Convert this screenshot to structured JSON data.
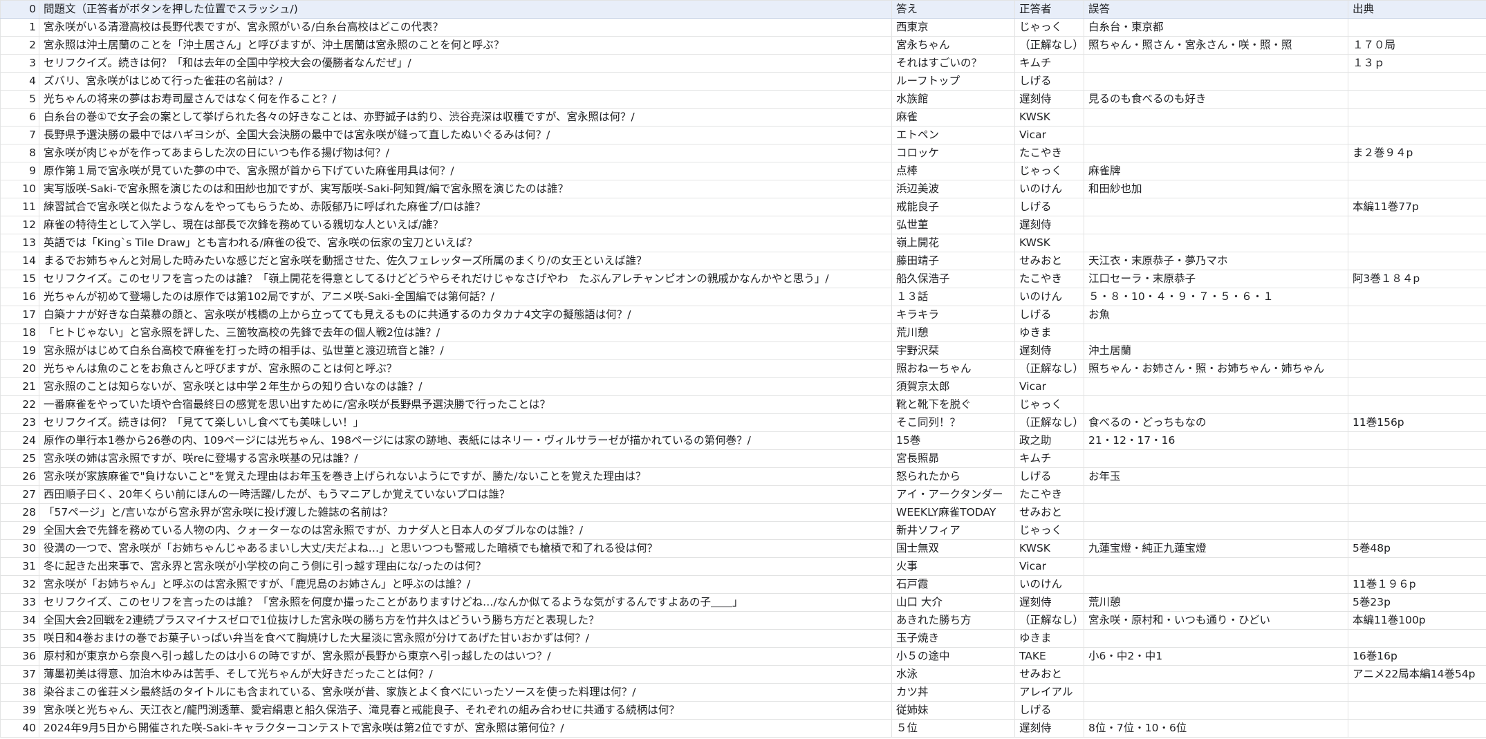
{
  "header": {
    "index": "0",
    "question": "問題文（正答者がボタンを押した位置でスラッシュ/)",
    "answer": "答え",
    "correct": "正答者",
    "wrong": "誤答",
    "source": "出典"
  },
  "rows": [
    {
      "i": "1",
      "q": "宮永咲がいる清澄高校は長野代表ですが、宮永照がいる/白糸台高校はどこの代表？",
      "a": "西東京",
      "c": "じゃっく",
      "w": "白糸台・東京都",
      "s": ""
    },
    {
      "i": "2",
      "q": "宮永照は沖土居蘭のことを「沖土居さん」と呼びますが、沖土居蘭は宮永照のことを何と呼ぶ？",
      "a": "宮永ちゃん",
      "c": "（正解なし）",
      "w": "照ちゃん・照さん・宮永さん・咲・照・照",
      "s": "１７０局"
    },
    {
      "i": "3",
      "q": "セリフクイズ。続きは何？「和は去年の全国中学校大会の優勝者なんだぜ」/",
      "a": "それはすごいの？",
      "c": "キムチ",
      "w": "",
      "s": "１３ｐ"
    },
    {
      "i": "4",
      "q": "ズバリ、宮永咲がはじめて行った雀荘の名前は？/",
      "a": "ルーフトップ",
      "c": "しげる",
      "w": "",
      "s": ""
    },
    {
      "i": "5",
      "q": "光ちゃんの将来の夢はお寿司屋さんではなく何を作ること？/",
      "a": "水族館",
      "c": "遅刻侍",
      "w": "見るのも食べるのも好き",
      "s": ""
    },
    {
      "i": "6",
      "q": "白糸台の巻①で女子会の案として挙げられた各々の好きなことは、亦野誠子は釣り、渋谷尭深は収穫ですが、宮永照は何？/",
      "a": "麻雀",
      "c": "KWSK",
      "w": "",
      "s": ""
    },
    {
      "i": "7",
      "q": "長野県予選決勝の最中ではハギヨシが、全国大会決勝の最中では宮永咲が縫って直したぬいぐるみは何？/",
      "a": "エトペン",
      "c": "Vicar",
      "w": "",
      "s": ""
    },
    {
      "i": "8",
      "q": "宮永咲が肉じゃがを作ってあまらした次の日にいつも作る揚げ物は何？/",
      "a": "コロッケ",
      "c": "たこやき",
      "w": "",
      "s": "ま２巻９４p"
    },
    {
      "i": "9",
      "q": "原作第１局で宮永咲が見ていた夢の中で、宮永照が首から下げていた麻雀用具は何？/",
      "a": "点棒",
      "c": "じゃっく",
      "w": "麻雀牌",
      "s": ""
    },
    {
      "i": "10",
      "q": "実写版咲-Saki-で宮永照を演じたのは和田紗也加ですが、実写版咲-Saki-阿知賀/編で宮永照を演じたのは誰？",
      "a": "浜辺美波",
      "c": "いのけん",
      "w": "和田紗也加",
      "s": ""
    },
    {
      "i": "11",
      "q": "練習試合で宮永咲と似たようなんをやってもらうため、赤阪郁乃に呼ばれた麻雀プ/ロは誰？",
      "a": "戒能良子",
      "c": "しげる",
      "w": "",
      "s": "本編11巻77p"
    },
    {
      "i": "12",
      "q": "麻雀の特待生として入学し、現在は部長で次鋒を務めている親切な人といえば/誰？",
      "a": "弘世菫",
      "c": "遅刻侍",
      "w": "",
      "s": ""
    },
    {
      "i": "13",
      "q": "英語では「King`s Tile Draw」とも言われる/麻雀の役で、宮永咲の伝家の宝刀といえば？",
      "a": "嶺上開花",
      "c": "KWSK",
      "w": "",
      "s": ""
    },
    {
      "i": "14",
      "q": "まるでお姉ちゃんと対局した時みたいな感じだと宮永咲を動揺させた、佐久フェレッターズ所属のまくり/の女王といえば誰？",
      "a": "藤田靖子",
      "c": "せみおと",
      "w": "天江衣・末原恭子・夢乃マホ",
      "s": ""
    },
    {
      "i": "15",
      "q": "セリフクイズ。このセリフを言ったのは誰？「嶺上開花を得意としてるけどどうやらそれだけじゃなさげやわ　たぶんアレチャンピオンの親戚かなんかやと思う」/",
      "a": "船久保浩子",
      "c": "たこやき",
      "w": "江口セーラ・末原恭子",
      "s": "阿3巻１８４p"
    },
    {
      "i": "16",
      "q": "光ちゃんが初めて登場したのは原作では第102局ですが、アニメ咲-Saki-全国編では第何話？/",
      "a": "１３話",
      "c": "いのけん",
      "w": "５・８・10・４・９・７・５・６・１",
      "s": ""
    },
    {
      "i": "17",
      "q": "白築ナナが好きな白菜慕の顔と、宮永咲が桟橋の上から立ってても見えるものに共通するのカタカナ4文字の擬態語は何？/",
      "a": "キラキラ",
      "c": "しげる",
      "w": "お魚",
      "s": ""
    },
    {
      "i": "18",
      "q": "「ヒトじゃない」と宮永照を評した、三箇牧高校の先鋒で去年の個人戦2位は誰？/",
      "a": "荒川憩",
      "c": "ゆきま",
      "w": "",
      "s": ""
    },
    {
      "i": "19",
      "q": "宮永照がはじめて白糸台高校で麻雀を打った時の相手は、弘世菫と渡辺琉音と誰？/",
      "a": "宇野沢栞",
      "c": "遅刻侍",
      "w": "沖土居蘭",
      "s": ""
    },
    {
      "i": "20",
      "q": "光ちゃんは魚のことをお魚さんと呼びますが、宮永照のことは何と呼ぶ？",
      "a": "照おねーちゃん",
      "c": "（正解なし）",
      "w": "照ちゃん・お姉さん・照・お姉ちゃん・姉ちゃん",
      "s": ""
    },
    {
      "i": "21",
      "q": "宮永照のことは知らないが、宮永咲とは中学２年生からの知り合いなのは誰？/",
      "a": "須賀京太郎",
      "c": "Vicar",
      "w": "",
      "s": ""
    },
    {
      "i": "22",
      "q": "一番麻雀をやっていた頃や合宿最終日の感覚を思い出すために/宮永咲が長野県予選決勝で行ったことは？",
      "a": "靴と靴下を脱ぐ",
      "c": "じゃっく",
      "w": "",
      "s": ""
    },
    {
      "i": "23",
      "q": "セリフクイズ。続きは何？「見てて楽しいし食べても美味しい！」",
      "a": "そこ同列！？",
      "c": "（正解なし）",
      "w": "食べるの・どっちもなの",
      "s": "11巻156p"
    },
    {
      "i": "24",
      "q": "原作の単行本1巻から26巻の内、109ページには光ちゃん、198ページには家の跡地、表紙にはネリー・ヴィルサラーゼが描かれているの第何巻？/",
      "a": "15巻",
      "c": "政之助",
      "w": "21・12・17・16",
      "s": ""
    },
    {
      "i": "25",
      "q": "宮永咲の姉は宮永照ですが、咲reに登場する宮永咲基の兄は誰？/",
      "a": "宮長照昴",
      "c": "キムチ",
      "w": "",
      "s": ""
    },
    {
      "i": "26",
      "q": "宮永咲が家族麻雀で\"負けないこと\"を覚えた理由はお年玉を巻き上げられないようにですが、勝た/ないことを覚えた理由は？",
      "a": "怒られたから",
      "c": "しげる",
      "w": "お年玉",
      "s": ""
    },
    {
      "i": "27",
      "q": "西田順子曰く、20年くらい前にほんの一時活躍/したが、もうマニアしか覚えていないプロは誰？",
      "a": "アイ・アークタンダー",
      "c": "たこやき",
      "w": "",
      "s": ""
    },
    {
      "i": "28",
      "q": "「57ページ」と/言いながら宮永界が宮永咲に投げ渡した雑誌の名前は？",
      "a": "WEEKLY麻雀TODAY",
      "c": "せみおと",
      "w": "",
      "s": ""
    },
    {
      "i": "29",
      "q": "全国大会で先鋒を務めている人物の内、クォーターなのは宮永照ですが、カナダ人と日本人のダブルなのは誰？/",
      "a": "新井ソフィア",
      "c": "じゃっく",
      "w": "",
      "s": ""
    },
    {
      "i": "30",
      "q": "役満の一つで、宮永咲が「お姉ちゃんじゃあるまいし大丈/夫だよね…」と思いつつも警戒した暗槓でも槍槓で和了れる役は何？",
      "a": "国士無双",
      "c": "KWSK",
      "w": "九蓮宝燈・純正九蓮宝燈",
      "s": "5巻48p"
    },
    {
      "i": "31",
      "q": "冬に起きた出来事で、宮永界と宮永咲が小学校の向こう側に引っ越す理由にな/ったのは何？",
      "a": "火事",
      "c": "Vicar",
      "w": "",
      "s": ""
    },
    {
      "i": "32",
      "q": "宮永咲が「お姉ちゃん」と呼ぶのは宮永照ですが、「鹿児島のお姉さん」と呼ぶのは誰？/",
      "a": "石戸霞",
      "c": "いのけん",
      "w": "",
      "s": "11巻１９６p"
    },
    {
      "i": "33",
      "q": "セリフクイズ、このセリフを言ったのは誰？「宮永照を何度か撮ったことがありますけどね…/なんか似てるような気がするんですよあの子＿＿」",
      "a": "山口 大介",
      "c": "遅刻侍",
      "w": "荒川憩",
      "s": "5巻23p"
    },
    {
      "i": "34",
      "q": "全国大会2回戦を2連続プラスマイナスゼロで1位抜けした宮永咲の勝ち方を竹井久はどういう勝ち方だと表現した？",
      "a": "あきれた勝ち方",
      "c": "（正解なし）",
      "w": "宮永咲・原村和・いつも通り・ひどい",
      "s": "本編11巻100p"
    },
    {
      "i": "35",
      "q": "咲日和4巻おまけの巻でお菓子いっぱい弁当を食べて胸焼けした大星淡に宮永照が分けてあげた甘いおかずは何？/",
      "a": "玉子焼き",
      "c": "ゆきま",
      "w": "",
      "s": ""
    },
    {
      "i": "36",
      "q": "原村和が東京から奈良へ引っ越したのは小６の時ですが、宮永照が長野から東京へ引っ越したのはいつ？/",
      "a": "小５の途中",
      "c": "TAKE",
      "w": "小6・中2・中1",
      "s": "16巻16p"
    },
    {
      "i": "37",
      "q": "薄墨初美は得意、加治木ゆみは苦手、そして光ちゃんが大好きだったことは何？/",
      "a": "水泳",
      "c": "せみおと",
      "w": "",
      "s": "アニメ22局本編14巻54p"
    },
    {
      "i": "38",
      "q": "染谷まこの雀荘メシ最終話のタイトルにも含まれている、宮永咲が昔、家族とよく食べにいったソースを使った料理は何？/",
      "a": "カツ丼",
      "c": "アレイアル",
      "w": "",
      "s": ""
    },
    {
      "i": "39",
      "q": "宮永咲と光ちゃん、天江衣と/龍門渕透華、愛宕絹恵と船久保浩子、滝見春と戒能良子、それぞれの組み合わせに共通する続柄は何？",
      "a": "従姉妹",
      "c": "しげる",
      "w": "",
      "s": ""
    },
    {
      "i": "40",
      "q": "2024年9月5日から開催された咲-Saki-キャラクターコンテストで宮永咲は第2位ですが、宮永照は第何位？/",
      "a": "５位",
      "c": "遅刻侍",
      "w": "8位・7位・10・6位",
      "s": ""
    }
  ]
}
